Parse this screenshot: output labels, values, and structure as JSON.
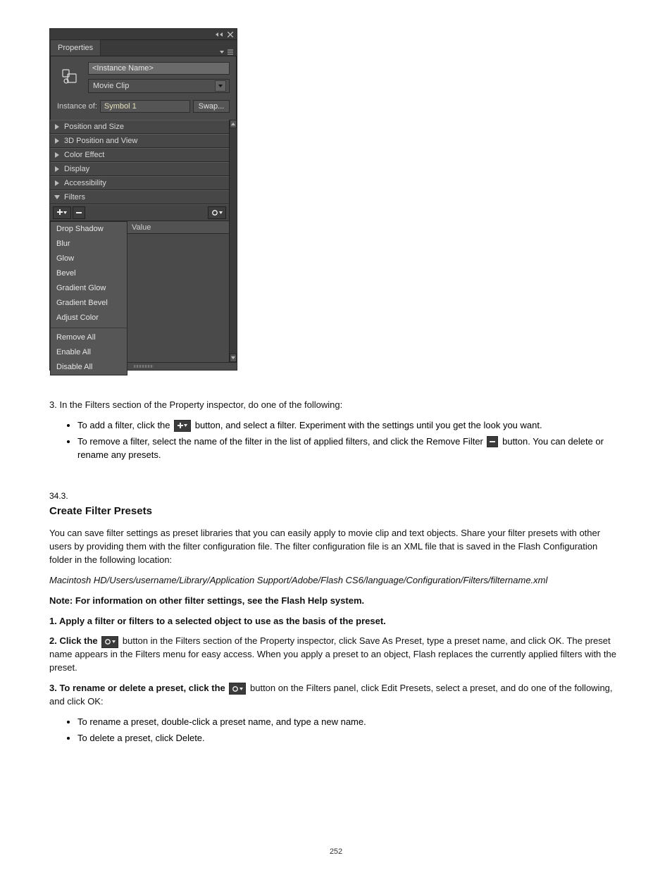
{
  "page_number": "252",
  "panel": {
    "tab": "Properties",
    "instance_name_placeholder": "<Instance Name>",
    "type_dropdown": "Movie Clip",
    "instance_of_label": "Instance of:",
    "instance_name": "Symbol 1",
    "swap_label": "Swap...",
    "sections": [
      {
        "label": "Position and Size",
        "expanded": false
      },
      {
        "label": "3D Position and View",
        "expanded": false
      },
      {
        "label": "Color Effect",
        "expanded": false
      },
      {
        "label": "Display",
        "expanded": false
      },
      {
        "label": "Accessibility",
        "expanded": false
      },
      {
        "label": "Filters",
        "expanded": true
      }
    ],
    "value_header": "Value",
    "filter_menu": {
      "groups": [
        [
          "Drop Shadow",
          "Blur",
          "Glow",
          "Bevel",
          "Gradient Glow",
          "Gradient Bevel",
          "Adjust Color"
        ],
        [
          "Remove All",
          "Enable All",
          "Disable All"
        ]
      ]
    }
  },
  "doc": {
    "step3_lead": "3.  In the Filters section of the Property inspector, do one of the following:",
    "bullet_add_a": "To add a filter, click the ",
    "bullet_add_b": " button, and select a filter. Experiment with the settings until you get the look you want.",
    "bullet_remove_a": "To remove a filter, select the name of the filter in the list of applied filters, and click the Remove Filter ",
    "bullet_remove_b": " button. You can delete or rename any presets.",
    "section_number": "34.3.",
    "h2": "Create Filter Presets",
    "para1_a": "You can save filter settings as preset libraries that you can easily apply to movie clip and text objects. Share your filter presets with other users by providing them with the filter configuration file. The filter configuration file is an XML file that is saved in the Flash Configuration folder in the following location:",
    "para1_path_mac": "Macintosh HD/Users/username/Library/Application Support/Adobe/Flash CS6/language/Configuration/Filters/filtername.xml",
    "note": "Note: For information on other filter settings, see the Flash Help system.",
    "step1": "1.  Apply a filter or filters to a selected object to use as the basis of the preset.",
    "step2_a": "2.  Click the ",
    "step2_b": "  button in the Filters section of the Property inspector, click Save As Preset, type a preset name, and click OK. The preset name appears in the Filters menu for easy access. When you apply a preset to an object, Flash replaces the currently applied filters with the preset.",
    "step3_a": "3.  To rename or delete a preset, click the ",
    "step3_b": " button on the Filters panel, click Edit Presets, select a preset, and do one of the following, and click OK:",
    "sub_bullet_rename": "To rename a preset, double-click a preset name, and type a new name.",
    "sub_bullet_delete": "To delete a preset, click Delete."
  }
}
